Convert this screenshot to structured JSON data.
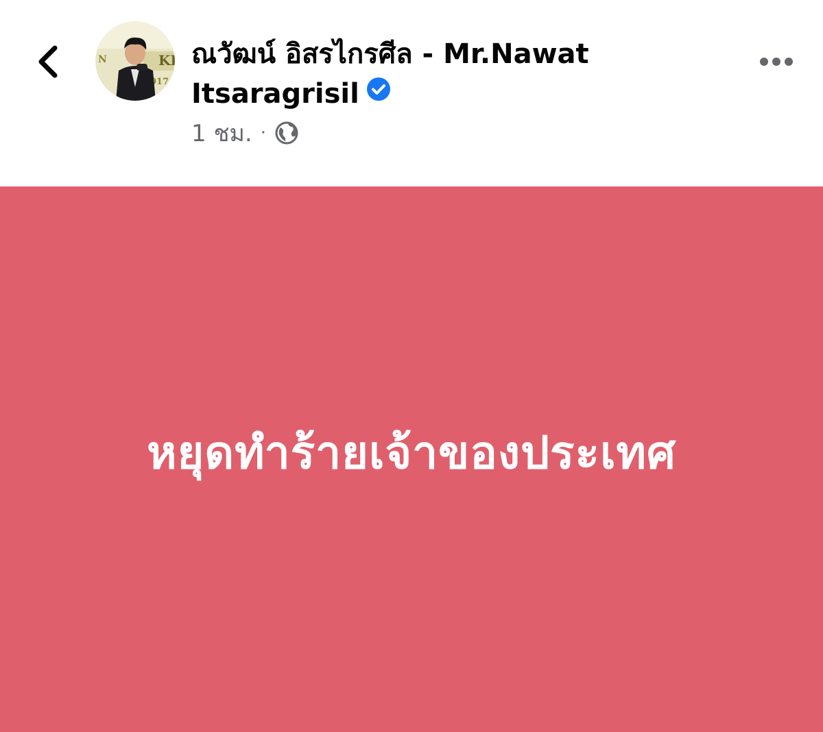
{
  "header": {
    "back_icon": "chevron-left-icon",
    "author_name_line1": "ณวัฒน์ อิสรไกรศีล - Mr.Nawat",
    "author_name_line2": "Itsaragrisil",
    "verified_icon": "verified-badge-icon",
    "timestamp": "1 ชม.",
    "separator": "·",
    "privacy_icon": "globe-icon",
    "more_icon": "more-horizontal-icon"
  },
  "post": {
    "text": "หยุดทำร้ายเจ้าของประเทศ",
    "background_color": "#e05f6c",
    "text_color": "#ffffff"
  },
  "colors": {
    "verified_blue": "#1877f2",
    "meta_gray": "#65676b",
    "name_black": "#050505"
  }
}
